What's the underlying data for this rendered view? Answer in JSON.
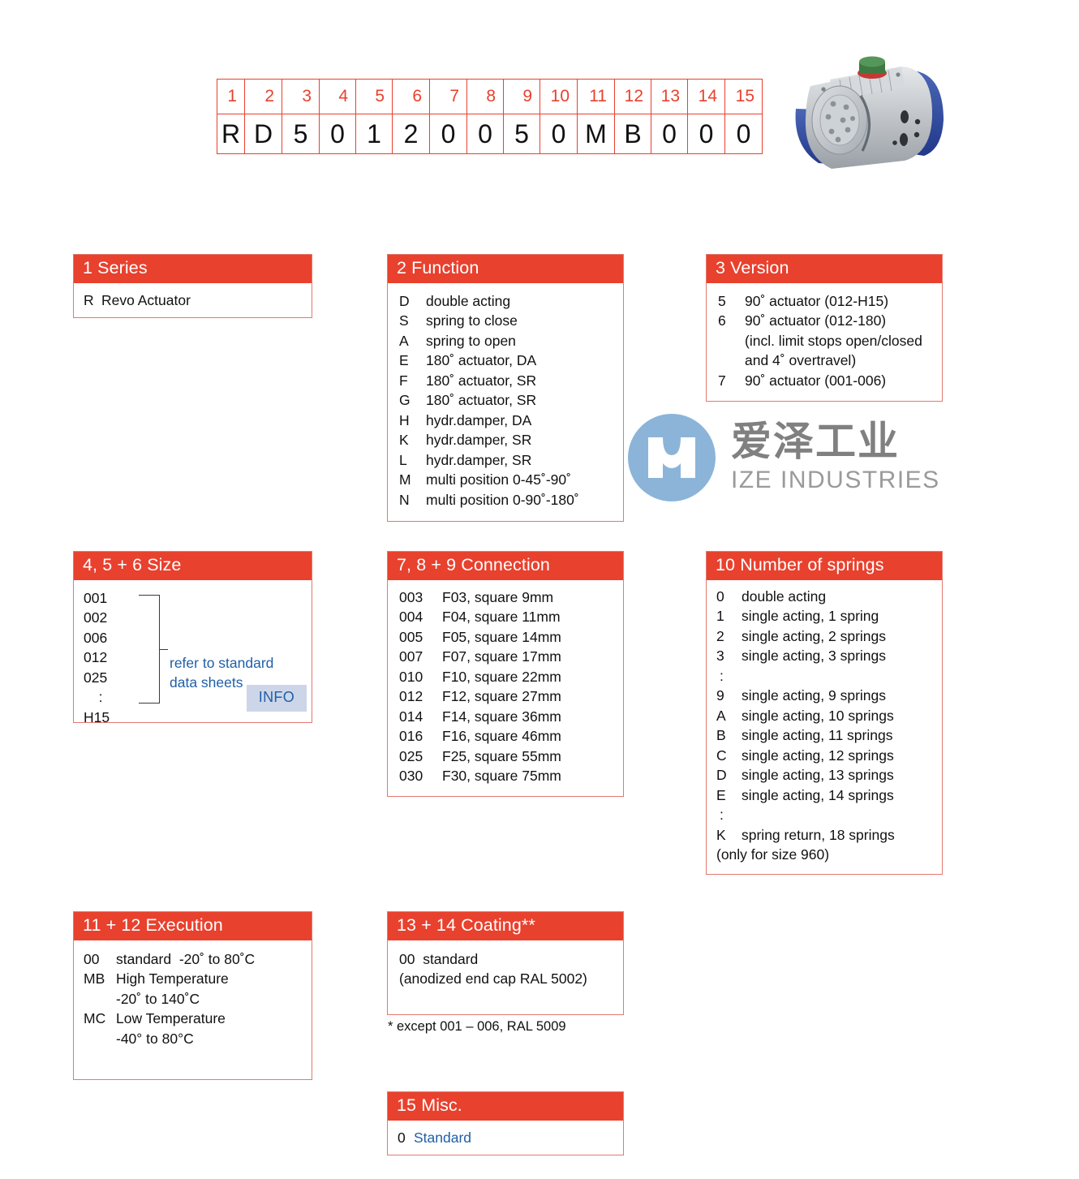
{
  "code_table": {
    "position_groups": [
      {
        "label": "1",
        "span": 1
      },
      {
        "label": "2",
        "span": 1
      },
      {
        "label": "3",
        "span": 1
      },
      {
        "label": "4",
        "span": 1
      },
      {
        "label": "5",
        "span": 1
      },
      {
        "label": "6",
        "span": 1
      },
      {
        "label": "7",
        "span": 1
      },
      {
        "label": "8",
        "span": 1
      },
      {
        "label": "9",
        "span": 1
      },
      {
        "label": "10",
        "span": 1
      },
      {
        "label": "11",
        "span": 1
      },
      {
        "label": "12",
        "span": 1
      },
      {
        "label": "13",
        "span": 1
      },
      {
        "label": "14",
        "span": 1
      },
      {
        "label": "15",
        "span": 1
      }
    ],
    "code_characters": [
      "R",
      "D",
      "5",
      "0",
      "1",
      "2",
      "0",
      "0",
      "5",
      "0",
      "M",
      "B",
      "0",
      "0",
      "0"
    ],
    "full_code": "RD50120050MB000"
  },
  "product_photo": {
    "alt": "pneumatic rotary actuator",
    "body_color": "#b9bdc2",
    "endcap_color": "#2f4fa0",
    "indicator_color": "#3b7a3b"
  },
  "series": {
    "header": "1  Series",
    "options": [
      {
        "key": "R",
        "value": "Revo Actuator"
      }
    ]
  },
  "function": {
    "header": "2  Function",
    "options": [
      {
        "key": "D",
        "value": "double acting"
      },
      {
        "key": "S",
        "value": "spring to close"
      },
      {
        "key": "A",
        "value": "spring to open"
      },
      {
        "key": "E",
        "value": "180˚ actuator, DA"
      },
      {
        "key": "F",
        "value": "180˚ actuator, SR"
      },
      {
        "key": "G",
        "value": "180˚ actuator, SR"
      },
      {
        "key": "H",
        "value": "hydr.damper, DA"
      },
      {
        "key": "K",
        "value": "hydr.damper, SR"
      },
      {
        "key": "L",
        "value": "hydr.damper, SR"
      },
      {
        "key": "M",
        "value": "multi position 0-45˚-90˚"
      },
      {
        "key": "N",
        "value": "multi position 0-90˚-180˚"
      }
    ]
  },
  "version": {
    "header": "3  Version",
    "options": [
      {
        "key": "5",
        "value": "90˚ actuator (012-H15)"
      },
      {
        "key": "6",
        "value": "90˚ actuator (012-180)"
      }
    ],
    "continuation_lines": [
      "(incl. limit stops open/closed",
      "and 4˚ overtravel)"
    ],
    "last_option": {
      "key": "7",
      "value": "90˚ actuator (001-006)"
    }
  },
  "size": {
    "header": "4, 5 + 6  Size",
    "codes": [
      "001",
      "002",
      "006",
      "012",
      "025",
      ":",
      "H15"
    ],
    "note_lines": [
      "refer to standard",
      "data sheets"
    ],
    "info_badge": "INFO"
  },
  "connection": {
    "header": "7, 8 + 9  Connection",
    "options": [
      {
        "key": "003",
        "value": "F03, square 9mm"
      },
      {
        "key": "004",
        "value": "F04, square 11mm"
      },
      {
        "key": "005",
        "value": "F05, square 14mm"
      },
      {
        "key": "007",
        "value": "F07, square 17mm"
      },
      {
        "key": "010",
        "value": "F10, square 22mm"
      },
      {
        "key": "012",
        "value": "F12, square 27mm"
      },
      {
        "key": "014",
        "value": "F14, square 36mm"
      },
      {
        "key": "016",
        "value": "F16, square 46mm"
      },
      {
        "key": "025",
        "value": "F25, square 55mm"
      },
      {
        "key": "030",
        "value": "F30, square 75mm"
      }
    ]
  },
  "springs": {
    "header": "10  Number of springs",
    "options": [
      {
        "key": "0",
        "value": "double acting"
      },
      {
        "key": "1",
        "value": "single acting, 1 spring"
      },
      {
        "key": "2",
        "value": "single acting, 2 springs"
      },
      {
        "key": "3",
        "value": "single acting, 3 springs"
      },
      {
        "key": ":",
        "value": ""
      },
      {
        "key": "9",
        "value": "single acting, 9 springs"
      },
      {
        "key": "A",
        "value": "single acting, 10 springs"
      },
      {
        "key": "B",
        "value": "single acting, 11 springs"
      },
      {
        "key": "C",
        "value": "single acting, 12 springs"
      },
      {
        "key": "D",
        "value": "single acting, 13 springs"
      },
      {
        "key": "E",
        "value": "single acting, 14 springs"
      },
      {
        "key": ":",
        "value": ""
      },
      {
        "key": "K",
        "value": "spring return, 18 springs"
      }
    ],
    "footer": "(only for size 960)"
  },
  "execution": {
    "header": "11 + 12  Execution",
    "options": [
      {
        "key": "00",
        "value": "standard  -20˚ to 80˚C"
      },
      {
        "key": "MB",
        "value": "High Temperature"
      }
    ],
    "mb_continuation": "-20˚ to 140˚C",
    "mc_option": {
      "key": "MC",
      "value": "Low Temperature"
    },
    "mc_continuation": "-40° to 80°C"
  },
  "coating": {
    "header": "13 + 14  Coating**",
    "lines": [
      "00  standard",
      "(anodized end cap RAL 5002)"
    ],
    "footnote": "* except 001 – 006, RAL 5009"
  },
  "misc": {
    "header": "15  Misc.",
    "option_key": "0",
    "option_value": "Standard"
  },
  "watermark": {
    "chinese": "爱泽工业",
    "english": "IZE INDUSTRIES",
    "mark_color": "#8cb4d9"
  },
  "colors": {
    "header_red": "#e8412e",
    "border_red": "#e3796f",
    "accent_blue": "#1f5fa8",
    "info_bg": "#ccd6e8",
    "text_black": "#111111"
  }
}
